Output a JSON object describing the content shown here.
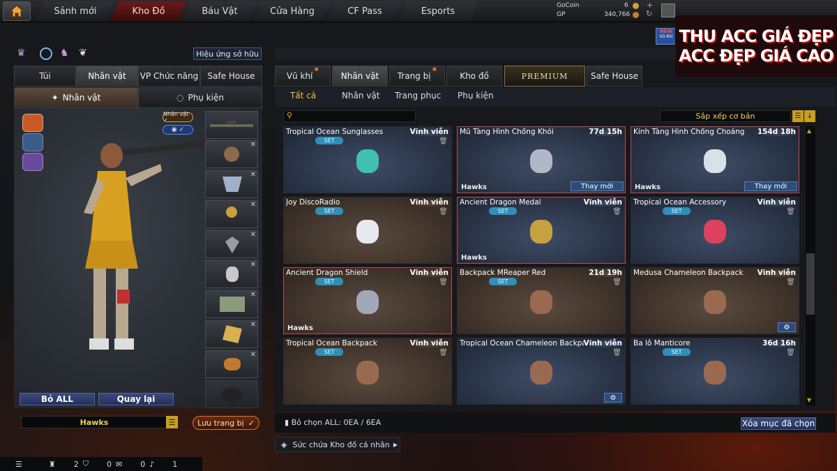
{
  "nav": {
    "tabs": [
      "Sảnh mới",
      "Kho Đồ",
      "Báu Vật",
      "Cửa Hàng",
      "CF Pass",
      "Esports"
    ],
    "active": 1
  },
  "currency": {
    "gocoin_label": "GoCoin",
    "gocoin_value": "6",
    "gp_label": "GP",
    "gp_value": "340,766"
  },
  "watermark": {
    "badge": "NEW",
    "badge_sub": "Vũ Khí",
    "line1": "THU ACC GIÁ ĐẸP",
    "line2": "ACC ĐẸP GIÁ CAO",
    "accent": "#e0e0e0"
  },
  "left": {
    "effects_button": "Hiệu ứng sở hữu",
    "tabs": [
      "Túi",
      "Nhân vật",
      "VP Chức năng",
      "Safe House"
    ],
    "subtabs": [
      "Nhân vật",
      "Phụ kiện"
    ],
    "badge_character": "Nhân vật ✓",
    "badge_eye": "✓",
    "btn_remove_all": "Bỏ ALL",
    "btn_back": "Quay lại",
    "clan_name": "Hawks",
    "save_button": "Lưu trang bị"
  },
  "right": {
    "tabs": [
      "Vũ khí",
      "Nhân vật",
      "Trang bị",
      "Kho đồ",
      "PREMIUM",
      "Safe House"
    ],
    "active_tab": 1,
    "filters": [
      "Tất cả",
      "Nhân vật",
      "Trang phục",
      "Phụ kiện"
    ],
    "active_filter": 0,
    "sort_label": "Sắp xếp cơ bản",
    "search_placeholder": "",
    "items": [
      {
        "name": "Tropical Ocean Sunglasses",
        "duration": "Vĩnh viễn",
        "set": "SET",
        "clan": "",
        "action": "",
        "tone": "blue",
        "icon": "sunglasses-icon"
      },
      {
        "name": "Mũ Tàng Hình Chống Khói",
        "duration": "77d 15h",
        "set": "",
        "clan": "Hawks",
        "action": "Thay mới",
        "tone": "blue",
        "icon": "helmet-icon"
      },
      {
        "name": "Kính Tàng Hình Chống Choáng",
        "duration": "154d 18h",
        "set": "",
        "clan": "Hawks",
        "action": "Thay mới",
        "tone": "blue",
        "icon": "goggles-icon"
      },
      {
        "name": "Joy DiscoRadio",
        "duration": "Vĩnh viễn",
        "set": "SET",
        "clan": "",
        "action": "",
        "tone": "brown",
        "icon": "radio-icon"
      },
      {
        "name": "Ancient Dragon Medal",
        "duration": "Vĩnh viễn",
        "set": "SET",
        "clan": "Hawks",
        "action": "",
        "tone": "blue",
        "icon": "medal-icon"
      },
      {
        "name": "Tropical Ocean Accessory",
        "duration": "Vĩnh viễn",
        "set": "SET",
        "clan": "",
        "action": "",
        "tone": "blue",
        "icon": "flower-icon"
      },
      {
        "name": "Ancient Dragon Shield",
        "duration": "Vĩnh viễn",
        "set": "SET",
        "clan": "Hawks",
        "action": "",
        "tone": "brown",
        "icon": "shield-icon"
      },
      {
        "name": "Backpack MReaper Red",
        "duration": "21d 19h",
        "set": "SET",
        "clan": "",
        "action": "",
        "tone": "brown",
        "icon": "backpack-icon"
      },
      {
        "name": "Medusa Chameleon Backpack",
        "duration": "Vĩnh viễn",
        "set": "",
        "clan": "",
        "action": "",
        "tone": "brown",
        "icon": "backpack-icon"
      },
      {
        "name": "Tropical Ocean Backpack",
        "duration": "Vĩnh viễn",
        "set": "SET",
        "clan": "",
        "action": "",
        "tone": "brown",
        "icon": "backpack-icon"
      },
      {
        "name": "Tropical Ocean Chameleon Backpack",
        "duration": "Vĩnh viễn",
        "set": "",
        "clan": "",
        "action": "",
        "tone": "blue",
        "icon": "backpack-icon"
      },
      {
        "name": "Ba lô Manticore",
        "duration": "36d 16h",
        "set": "SET",
        "clan": "",
        "action": "",
        "tone": "blue",
        "icon": "backpack-icon"
      }
    ],
    "selected_info": "Bỏ chọn ALL: 0EA / 6EA",
    "delete_selected": "Xóa mục đã chọn",
    "capacity": "Sức chứa Kho đồ cá nhân"
  },
  "statusbar": {
    "count1": "2",
    "count2": "0",
    "count3": "0",
    "count4": "1"
  }
}
